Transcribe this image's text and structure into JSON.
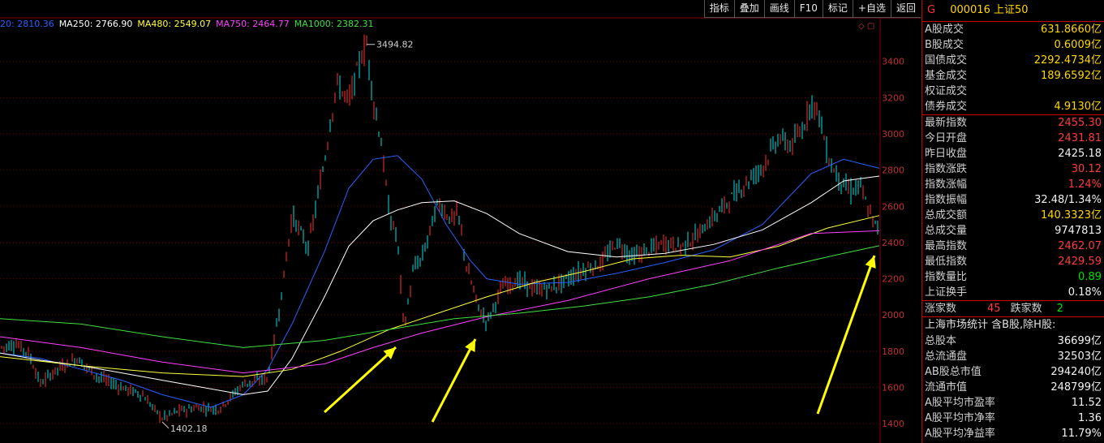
{
  "toolbar": {
    "buttons": [
      "指标",
      "叠加",
      "画线",
      "F10",
      "标记",
      "+自选",
      "返回"
    ]
  },
  "ma_legend": [
    {
      "label": "20: 2810.36",
      "color": "#2a60ff"
    },
    {
      "label": "MA250: 2766.90",
      "color": "#ffffff"
    },
    {
      "label": "MA480: 2549.07",
      "color": "#ffff40"
    },
    {
      "label": "MA750: 2464.77",
      "color": "#ff40ff"
    },
    {
      "label": "MA1000: 2382.31",
      "color": "#40e040"
    }
  ],
  "header": {
    "code": "000016",
    "name": "上证50",
    "letter": "G"
  },
  "trading": [
    {
      "k": "A股成交",
      "v": "631.8660亿"
    },
    {
      "k": "B股成交",
      "v": "0.6009亿"
    },
    {
      "k": "国债成交",
      "v": "2292.4734亿"
    },
    {
      "k": "基金成交",
      "v": "189.6592亿"
    },
    {
      "k": "权证成交",
      "v": ""
    },
    {
      "k": "债券成交",
      "v": "4.9130亿"
    }
  ],
  "quote": [
    {
      "k": "最新指数",
      "v": "2455.30",
      "c": "red"
    },
    {
      "k": "今日开盘",
      "v": "2431.81",
      "c": "red"
    },
    {
      "k": "昨日收盘",
      "v": "2425.18",
      "c": "white"
    },
    {
      "k": "指数涨跌",
      "v": "30.12",
      "c": "red"
    },
    {
      "k": "指数涨幅",
      "v": "1.24%",
      "c": "red"
    },
    {
      "k": "指数振幅",
      "v": "32.48/1.34%",
      "c": "white"
    },
    {
      "k": "总成交额",
      "v": "140.3323亿",
      "c": "yellow"
    },
    {
      "k": "总成交量",
      "v": "9747813",
      "c": "white"
    },
    {
      "k": "最高指数",
      "v": "2462.07",
      "c": "red"
    },
    {
      "k": "最低指数",
      "v": "2429.59",
      "c": "red"
    },
    {
      "k": "指数量比",
      "v": "0.89",
      "c": "green"
    },
    {
      "k": "上证换手",
      "v": "0.18%",
      "c": "white"
    }
  ],
  "breadth": {
    "up_label": "涨家数",
    "up": "45",
    "down_label": "跌家数",
    "down": "2"
  },
  "stats_title": "上海市场统计 含B股,除H股:",
  "stats": [
    {
      "k": "总股本",
      "v": "36699亿"
    },
    {
      "k": "总流通盘",
      "v": "32503亿"
    },
    {
      "k": "AB股总市值",
      "v": "294240亿"
    },
    {
      "k": "流通市值",
      "v": "248799亿"
    },
    {
      "k": "A股平均市盈率",
      "v": "11.52"
    },
    {
      "k": "A股平均市净率",
      "v": "1.36"
    },
    {
      "k": "A股平均净益率",
      "v": "11.79%"
    }
  ],
  "chart_data": {
    "type": "line",
    "y_ticks": [
      1400,
      1600,
      1800,
      2000,
      2200,
      2400,
      2600,
      2800,
      3000,
      3200,
      3400
    ],
    "ylim": [
      1320,
      3560
    ],
    "xlim": [
      0,
      1084
    ],
    "annotations": {
      "high": "3494.82",
      "low": "1402.18"
    },
    "colors": {
      "price": "#ff3030",
      "ma20": "#2a60ff",
      "ma250": "#ffffff",
      "ma480": "#ffff40",
      "ma750": "#ff40ff",
      "ma1000": "#40e040",
      "arrow": "#ffff00"
    },
    "series": [
      {
        "name": "price",
        "color": "#ff3030",
        "x": [
          0,
          20,
          35,
          50,
          70,
          95,
          120,
          150,
          175,
          200,
          220,
          245,
          270,
          300,
          330,
          345,
          360,
          380,
          400,
          415,
          430,
          445,
          452,
          460,
          470,
          480,
          490,
          498,
          510,
          520,
          540,
          555,
          565,
          575,
          590,
          600,
          620,
          640,
          660,
          680,
          700,
          720,
          740,
          760,
          780,
          800,
          820,
          840,
          860,
          880,
          900,
          920,
          940,
          960,
          975,
          990,
          1000,
          1010,
          1020,
          1030,
          1040,
          1050,
          1060,
          1070,
          1084
        ],
        "y": [
          1820,
          1840,
          1790,
          1620,
          1700,
          1760,
          1660,
          1600,
          1560,
          1430,
          1470,
          1490,
          1480,
          1620,
          1650,
          2050,
          2550,
          2370,
          2850,
          3280,
          3180,
          3420,
          3494,
          3190,
          2950,
          2550,
          2420,
          1920,
          2260,
          2310,
          2620,
          2530,
          2560,
          2270,
          2040,
          1960,
          2160,
          2190,
          2140,
          2150,
          2200,
          2250,
          2280,
          2400,
          2320,
          2360,
          2400,
          2380,
          2440,
          2540,
          2640,
          2730,
          2820,
          2980,
          2930,
          3030,
          3180,
          3110,
          2880,
          2780,
          2720,
          2680,
          2720,
          2580,
          2455
        ]
      },
      {
        "name": "MA20",
        "color": "#2a60ff",
        "x": [
          0,
          50,
          100,
          150,
          200,
          260,
          300,
          330,
          360,
          400,
          430,
          460,
          490,
          520,
          550,
          580,
          600,
          640,
          700,
          760,
          820,
          880,
          940,
          1000,
          1040,
          1084
        ],
        "y": [
          1790,
          1760,
          1700,
          1640,
          1560,
          1490,
          1560,
          1700,
          1950,
          2350,
          2700,
          2860,
          2880,
          2750,
          2500,
          2300,
          2200,
          2170,
          2180,
          2230,
          2290,
          2360,
          2500,
          2780,
          2860,
          2810
        ]
      },
      {
        "name": "MA250",
        "color": "#ffffff",
        "x": [
          0,
          50,
          100,
          150,
          200,
          250,
          300,
          330,
          360,
          400,
          430,
          460,
          490,
          520,
          560,
          600,
          640,
          700,
          760,
          820,
          880,
          940,
          1000,
          1040,
          1084
        ],
        "y": [
          1790,
          1750,
          1720,
          1680,
          1640,
          1600,
          1560,
          1580,
          1760,
          2100,
          2380,
          2520,
          2580,
          2620,
          2630,
          2560,
          2450,
          2350,
          2320,
          2340,
          2390,
          2470,
          2620,
          2740,
          2767
        ]
      },
      {
        "name": "MA480",
        "color": "#ffff40",
        "x": [
          0,
          100,
          200,
          300,
          360,
          420,
          480,
          540,
          600,
          660,
          720,
          780,
          840,
          900,
          960,
          1020,
          1084
        ],
        "y": [
          1770,
          1720,
          1680,
          1660,
          1700,
          1800,
          1920,
          2010,
          2100,
          2180,
          2240,
          2310,
          2330,
          2320,
          2380,
          2480,
          2549
        ]
      },
      {
        "name": "MA750",
        "color": "#ff40ff",
        "x": [
          0,
          100,
          200,
          300,
          400,
          460,
          520,
          600,
          700,
          800,
          900,
          1000,
          1084
        ],
        "y": [
          1880,
          1820,
          1740,
          1680,
          1730,
          1820,
          1900,
          1990,
          2080,
          2200,
          2300,
          2450,
          2465
        ]
      },
      {
        "name": "MA1000",
        "color": "#40e040",
        "x": [
          0,
          100,
          200,
          300,
          400,
          480,
          560,
          640,
          720,
          800,
          880,
          960,
          1040,
          1084
        ],
        "y": [
          1980,
          1950,
          1880,
          1820,
          1860,
          1920,
          1980,
          2010,
          2050,
          2100,
          2170,
          2260,
          2340,
          2382
        ]
      }
    ]
  }
}
